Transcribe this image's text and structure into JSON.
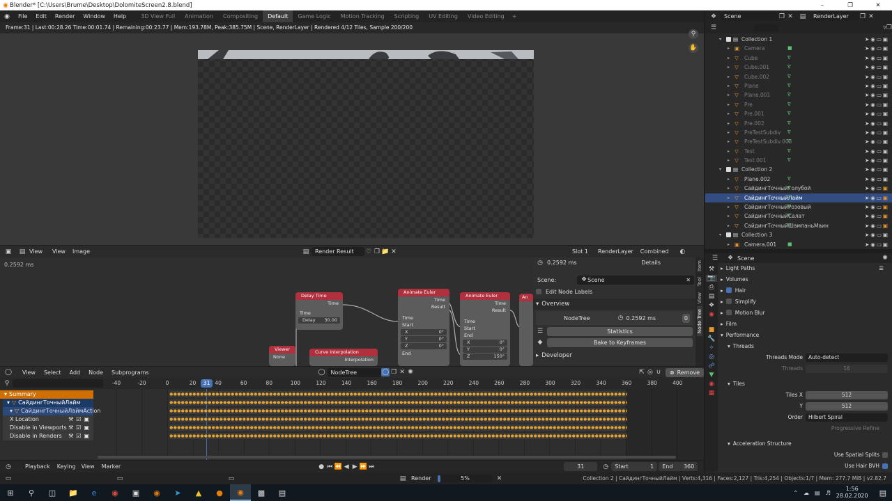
{
  "window": {
    "title": "Blender* [C:\\Users\\Brume\\Desktop\\DolomiteScreen2.8.blend]",
    "controls": [
      "–",
      "❐",
      "✕"
    ]
  },
  "menu": [
    "File",
    "Edit",
    "Render",
    "Window",
    "Help"
  ],
  "workspaces": [
    "3D View Full",
    "Animation",
    "Compositing",
    "Default",
    "Game Logic",
    "Motion Tracking",
    "Scripting",
    "UV Editing",
    "Video Editing"
  ],
  "active_workspace": "Default",
  "scene": {
    "label": "Scene",
    "renderlayer": "RenderLayer"
  },
  "render_status": "Frame:31 | Last:00:28.26 Time:00:01.74 | Remaining:00:23.77 | Mem:193.78M, Peak:385.75M | Scene, RenderLayer | Rendered 4/12 Tiles, Sample 200/200",
  "image_editor": {
    "menus": [
      "View",
      "View",
      "Image"
    ],
    "image_name": "Render Result",
    "slot": "Slot 1",
    "layer": "RenderLayer",
    "pass": "Combined"
  },
  "node_editor": {
    "time_readout": "0.2592 ms",
    "menus": [
      "View",
      "Select",
      "Add",
      "Node",
      "Subprograms"
    ],
    "tree": "NodeTree",
    "remove": "Remove"
  },
  "nodes": [
    {
      "title": "Delay Time",
      "rows": [
        "Time",
        "Time"
      ],
      "field_label": "Delay",
      "field_value": "30.00"
    },
    {
      "title": "Viewer",
      "rows": [
        "None"
      ]
    },
    {
      "title": "Curve Interpolation",
      "rows": [
        "Interpolation"
      ]
    },
    {
      "title": "Animate Euler",
      "rows": [
        "Time",
        "Result",
        "Time",
        "Start"
      ],
      "fields": [
        [
          "X",
          "0°"
        ],
        [
          "Y",
          "0°"
        ],
        [
          "Z",
          "0°"
        ]
      ],
      "end": "End"
    },
    {
      "title": "Animate Euler",
      "rows": [
        "Time",
        "Result",
        "Time",
        "Start",
        "End"
      ],
      "fields": [
        [
          "X",
          "0°"
        ],
        [
          "Y",
          "0°"
        ],
        [
          "Z",
          "150°"
        ]
      ]
    },
    {
      "title": "An"
    }
  ],
  "n_panel": {
    "time": "0.2592 ms",
    "details": "Details",
    "scene_label": "Scene:",
    "scene_value": "Scene",
    "edit_node_labels": "Edit Node Labels",
    "overview": "Overview",
    "nodetree": "NodeTree",
    "nodetree_time": "0.2592 ms",
    "nodetree_count": "0",
    "statistics": "Statistics",
    "bake": "Bake to Keyframes",
    "developer": "Developer",
    "tabs": [
      "Item",
      "Tool",
      "View",
      "Node Tree"
    ]
  },
  "dopesheet": {
    "ticks": [
      "-40",
      "-20",
      "0",
      "20",
      "40",
      "60",
      "80",
      "100",
      "120",
      "140",
      "160",
      "180",
      "200",
      "220",
      "240",
      "260",
      "280",
      "300",
      "320",
      "340",
      "360",
      "380",
      "400"
    ],
    "current_frame": "31",
    "channels": [
      "Summary",
      "СайдингТочныйЛайм",
      "СайдингТочныйЛаймAction",
      "X Location",
      "Disable in Viewports",
      "Disable in Renders"
    ]
  },
  "timeline": {
    "menus": [
      "Playback",
      "Keying",
      "View",
      "Marker"
    ],
    "frame": "31",
    "start_label": "Start",
    "start": "1",
    "end_label": "End",
    "end": "360"
  },
  "outliner": {
    "rows": [
      {
        "n": "Collection 1",
        "t": "col",
        "lvl": 1
      },
      {
        "n": "Camera",
        "t": "cam",
        "lvl": 2,
        "dim": true
      },
      {
        "n": "Cube",
        "t": "obj",
        "lvl": 2,
        "dim": true
      },
      {
        "n": "Cube.001",
        "t": "obj",
        "lvl": 2,
        "dim": true
      },
      {
        "n": "Cube.002",
        "t": "obj",
        "lvl": 2,
        "dim": true
      },
      {
        "n": "Plane",
        "t": "obj",
        "lvl": 2,
        "dim": true
      },
      {
        "n": "Plane.001",
        "t": "obj",
        "lvl": 2,
        "dim": true
      },
      {
        "n": "Pre",
        "t": "obj",
        "lvl": 2,
        "dim": true
      },
      {
        "n": "Pre.001",
        "t": "obj",
        "lvl": 2,
        "dim": true
      },
      {
        "n": "Pre.002",
        "t": "obj",
        "lvl": 2,
        "dim": true
      },
      {
        "n": "PreTestSubdiv",
        "t": "obj",
        "lvl": 2,
        "dim": true
      },
      {
        "n": "PreTestSubdiv.003",
        "t": "obj",
        "lvl": 2,
        "dim": true
      },
      {
        "n": "Test",
        "t": "obj",
        "lvl": 2,
        "dim": true
      },
      {
        "n": "Test.001",
        "t": "obj",
        "lvl": 2,
        "dim": true
      },
      {
        "n": "Collection 2",
        "t": "col",
        "lvl": 1
      },
      {
        "n": "Plane.002",
        "t": "obj",
        "lvl": 2
      },
      {
        "n": "СайдингТочныйГолубой",
        "t": "obj",
        "lvl": 2
      },
      {
        "n": "СайдингТочныйЛайм",
        "t": "obj",
        "lvl": 2,
        "sel": true
      },
      {
        "n": "СайдингТочныйРозовый",
        "t": "obj",
        "lvl": 2
      },
      {
        "n": "СайдингТочныйСалат",
        "t": "obj",
        "lvl": 2
      },
      {
        "n": "СайдингТочныйШампаньМаин",
        "t": "obj",
        "lvl": 2
      },
      {
        "n": "Collection 3",
        "t": "col",
        "lvl": 1
      },
      {
        "n": "Camera.001",
        "t": "cam",
        "lvl": 2
      }
    ]
  },
  "properties": {
    "scene": "Scene",
    "rows": [
      {
        "n": "Light Paths",
        "k": "panel"
      },
      {
        "n": "Volumes",
        "k": "panel"
      },
      {
        "n": "Hair",
        "k": "check",
        "on": true
      },
      {
        "n": "Simplify",
        "k": "check",
        "on": false
      },
      {
        "n": "Motion Blur",
        "k": "check",
        "on": false
      },
      {
        "n": "Film",
        "k": "panel"
      },
      {
        "n": "Performance",
        "k": "open"
      },
      {
        "n": "Threads",
        "k": "sub"
      },
      {
        "n": "Threads Mode",
        "k": "val",
        "v": "Auto-detect"
      },
      {
        "n": "Threads",
        "k": "num",
        "v": "16",
        "dim": true
      },
      {
        "n": "",
        "k": "gap"
      },
      {
        "n": "Tiles",
        "k": "sub"
      },
      {
        "n": "Tiles X",
        "k": "num",
        "v": "512"
      },
      {
        "n": "Y",
        "k": "num",
        "v": "512"
      },
      {
        "n": "Order",
        "k": "val",
        "v": "Hilbert Spiral"
      },
      {
        "n": "Progressive Refine",
        "k": "chk",
        "dim": true
      },
      {
        "n": "",
        "k": "gap"
      },
      {
        "n": "Acceleration Structure",
        "k": "sub"
      },
      {
        "n": "Use Spatial Splits",
        "k": "chk",
        "on": false
      },
      {
        "n": "Use Hair BVH",
        "k": "chk",
        "on": true
      }
    ]
  },
  "status_bar": {
    "render_label": "Render",
    "render_progress": 0.05,
    "render_pct": "5%",
    "info": "Collection 2 | СайдингТочныйЛайм | Verts:4,316 | Faces:2,127 | Tris:4,254 | Objects:1/7 | Mem: 277.7 MiB | v2.82.7"
  },
  "taskbar": {
    "time": "1:56",
    "date": "28.02.2020"
  },
  "colors": {
    "accent": "#4772b3",
    "keyframe": "#e6a22e",
    "node_header": "#b0303d",
    "selection": "#334d80"
  }
}
